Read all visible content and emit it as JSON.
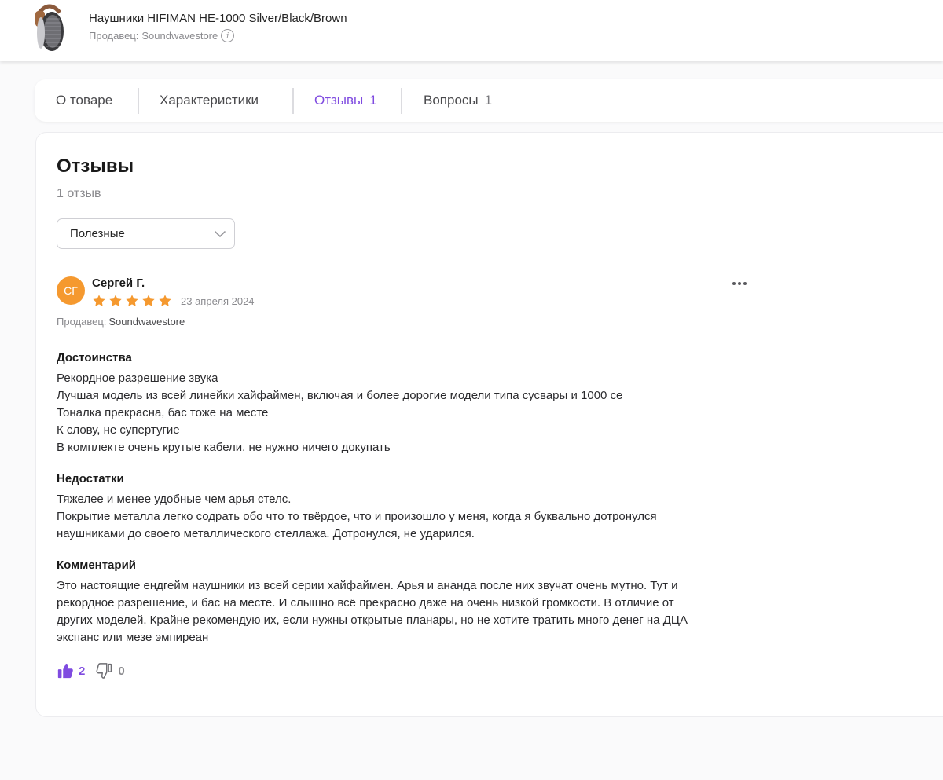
{
  "header": {
    "product_title": "Наушники HIFIMAN HE-1000 Silver/Black/Brown",
    "seller_prefix": "Продавец:",
    "seller_name": "Soundwavestore",
    "info_icon": "info-icon"
  },
  "tabs": [
    {
      "label": "О товаре",
      "count": ""
    },
    {
      "label": "Характеристики",
      "count": ""
    },
    {
      "label": "Отзывы",
      "count": "1"
    },
    {
      "label": "Вопросы",
      "count": "1"
    }
  ],
  "reviews": {
    "title": "Отзывы",
    "count_text": "1 отзыв",
    "sort_selected": "Полезные"
  },
  "review": {
    "initials": "СГ",
    "author": "Сергей Г.",
    "rating": 5,
    "date": "23 апреля 2024",
    "seller_prefix": "Продавец:",
    "seller_name": "Soundwavestore",
    "pros_title": "Достоинства",
    "pros_lines": [
      "Рекордное разрешение звука",
      "Лучшая модель из всей линейки хайфаймен, включая и более дорогие модели типа сусвары и 1000 се",
      "Тоналка прекрасна, бас тоже на месте",
      "К слову, не супертугие",
      "В комплекте очень крутые кабели, не нужно ничего докупать"
    ],
    "cons_title": "Недостатки",
    "cons_lines": [
      "Тяжелее и менее удобные чем арья стелс.",
      "Покрытие металла легко содрать обо что то твёрдое, что и произошло у меня, когда я буквально дотронулся",
      "наушниками до своего металлического стеллажа. Дотронулся, не ударился."
    ],
    "comment_title": "Комментарий",
    "comment_lines": [
      "Это настоящие ендгейм наушники из всей серии хайфаймен. Арья и ананда после них звучат очень мутно. Тут и",
      "рекордное разрешение, и бас на месте. И слышно всё прекрасно даже на очень низкой громкости. В отличие от",
      "других моделей. Крайне рекомендую их, если нужны открытые планары, но не хотите тратить много денег на ДЦА",
      "экспанс или мезе эмпиреан"
    ],
    "likes": "2",
    "dislikes": "0"
  },
  "colors": {
    "accent": "#7f4be0",
    "star": "#f5992f",
    "avatar": "#f5992f"
  }
}
